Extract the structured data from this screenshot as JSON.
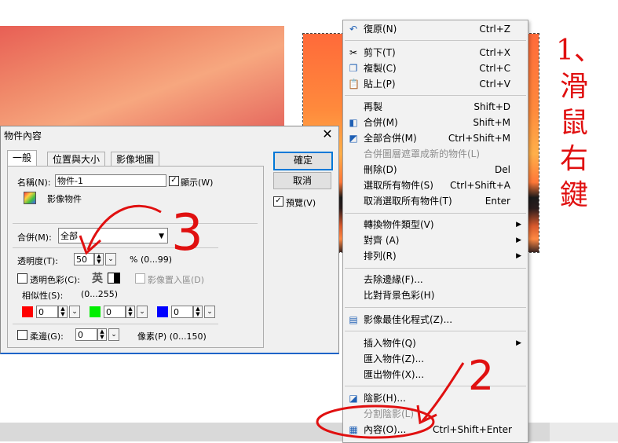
{
  "dialog": {
    "title": "物件內容",
    "close_label": "✕",
    "tabs": [
      "一般",
      "位置與大小",
      "影像地圖"
    ],
    "name_label": "名稱(N):",
    "name_value": "物件-1",
    "display_label": "顯示(W)",
    "object_type": "影像物件",
    "merge_label": "合併(M):",
    "merge_value": "全部",
    "opacity_label": "透明度(T):",
    "opacity_value": "50",
    "opacity_range": "% (0...99)",
    "transparent_color_label": "透明色彩(C):",
    "ime_label": "英",
    "image_to_area_label": "影像置入區(D)",
    "similarity_label": "相似性(S):",
    "similarity_range": "(0...255)",
    "rgb": {
      "r": "0",
      "g": "0",
      "b": "0"
    },
    "feather_label": "柔邊(G):",
    "feather_value": "0",
    "feather_range": "像素(P) (0...150)",
    "ok_label": "確定",
    "cancel_label": "取消",
    "preview_label": "預覽(V)",
    "swatch_colors": {
      "red": "#ff0000",
      "green": "#00ee00",
      "blue": "#0000ff"
    }
  },
  "menu": {
    "items": [
      {
        "label": "復原(N)",
        "shortcut": "Ctrl+Z",
        "icon": "undo-icon"
      },
      {
        "label": "剪下(T)",
        "shortcut": "Ctrl+X",
        "icon": "scissors-icon"
      },
      {
        "label": "複製(C)",
        "shortcut": "Ctrl+C",
        "icon": "copy-icon"
      },
      {
        "label": "貼上(P)",
        "shortcut": "Ctrl+V",
        "icon": "paste-icon"
      },
      {
        "label": "再製",
        "shortcut": "Shift+D"
      },
      {
        "label": "合併(M)",
        "shortcut": "Shift+M",
        "icon": "merge-icon"
      },
      {
        "label": "全部合併(M)",
        "shortcut": "Ctrl+Shift+M",
        "icon": "merge-all-icon"
      },
      {
        "label": "合併圖層遮罩成新的物件(L)",
        "shortcut": "",
        "disabled": true
      },
      {
        "label": "刪除(D)",
        "shortcut": "Del"
      },
      {
        "label": "選取所有物件(S)",
        "shortcut": "Ctrl+Shift+A"
      },
      {
        "label": "取消選取所有物件(T)",
        "shortcut": "Enter"
      },
      {
        "label": "轉換物件類型(V)",
        "shortcut": "",
        "submenu": true
      },
      {
        "label": "對齊 (A)",
        "shortcut": "",
        "submenu": true
      },
      {
        "label": "排列(R)",
        "shortcut": "",
        "submenu": true
      },
      {
        "label": "去除邊緣(F)...",
        "shortcut": ""
      },
      {
        "label": "比對背景色彩(H)",
        "shortcut": ""
      },
      {
        "label": "影像最佳化程式(Z)...",
        "shortcut": "",
        "icon": "optimizer-icon"
      },
      {
        "label": "插入物件(Q)",
        "shortcut": "",
        "submenu": true
      },
      {
        "label": "匯入物件(Z)...",
        "shortcut": ""
      },
      {
        "label": "匯出物件(X)...",
        "shortcut": ""
      },
      {
        "label": "陰影(H)...",
        "shortcut": "",
        "icon": "shadow-icon"
      },
      {
        "label": "分割陰影(L)",
        "shortcut": "",
        "disabled": true
      },
      {
        "label": "內容(O)...",
        "shortcut": "Ctrl+Shift+Enter",
        "icon": "properties-icon"
      }
    ]
  },
  "annotation": {
    "right_text": "1、滑鼠右鍵",
    "number_2": "2",
    "number_3": "3",
    "color": "#e01010"
  }
}
